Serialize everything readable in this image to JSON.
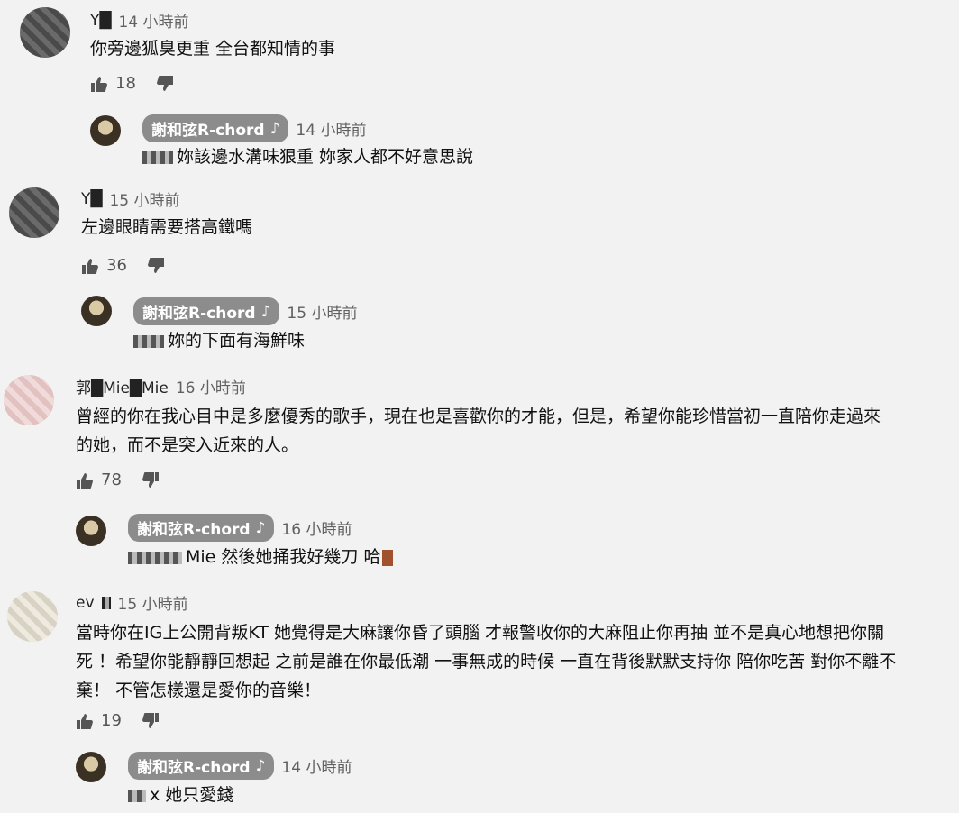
{
  "comments": [
    {
      "author": "Y█",
      "time": "14 小時前",
      "text": "你旁邊狐臭更重 全台都知情的事",
      "likes": "18",
      "reply": {
        "author": "謝和弦R-chord",
        "note_icon": "♪",
        "time": "14 小時前",
        "text": "妳該邊水溝味狠重 妳家人都不好意思說"
      }
    },
    {
      "author": "Y█",
      "time": "15 小時前",
      "text": "左邊眼睛需要搭高鐵嗎",
      "likes": "36",
      "reply": {
        "author": "謝和弦R-chord",
        "note_icon": "♪",
        "time": "15 小時前",
        "text": "妳的下面有海鮮味"
      }
    },
    {
      "author": "郭█Mie█Mie",
      "time": "16 小時前",
      "text_line1": "曾經的你在我心目中是多麼優秀的歌手，現在也是喜歡你的才能，但是，希望你能珍惜當初一直陪你走過來",
      "text_line2": "的她，而不是突入近來的人。",
      "likes": "78",
      "reply": {
        "author": "謝和弦R-chord",
        "note_icon": "♪",
        "time": "16 小時前",
        "mention": "Mie",
        "text": "然後她捅我好幾刀 哈"
      }
    },
    {
      "author": "ev",
      "time": "15 小時前",
      "text_line1": "當時你在IG上公開背叛KT 她覺得是大麻讓你昏了頭腦 才報警收你的大麻阻止你再抽 並不是真心地想把你關",
      "text_line2": "死 ！希望你能靜靜回想起 之前是誰在你最低潮 一事無成的時候 一直在背後默默支持你 陪你吃苦 對你不離不",
      "text_line3": "棄！ 不管怎樣還是愛你的音樂！",
      "likes": "19",
      "reply": {
        "author": "謝和弦R-chord",
        "note_icon": "♪",
        "time": "14 小時前",
        "mention": "x",
        "text": "她只愛錢"
      }
    }
  ]
}
